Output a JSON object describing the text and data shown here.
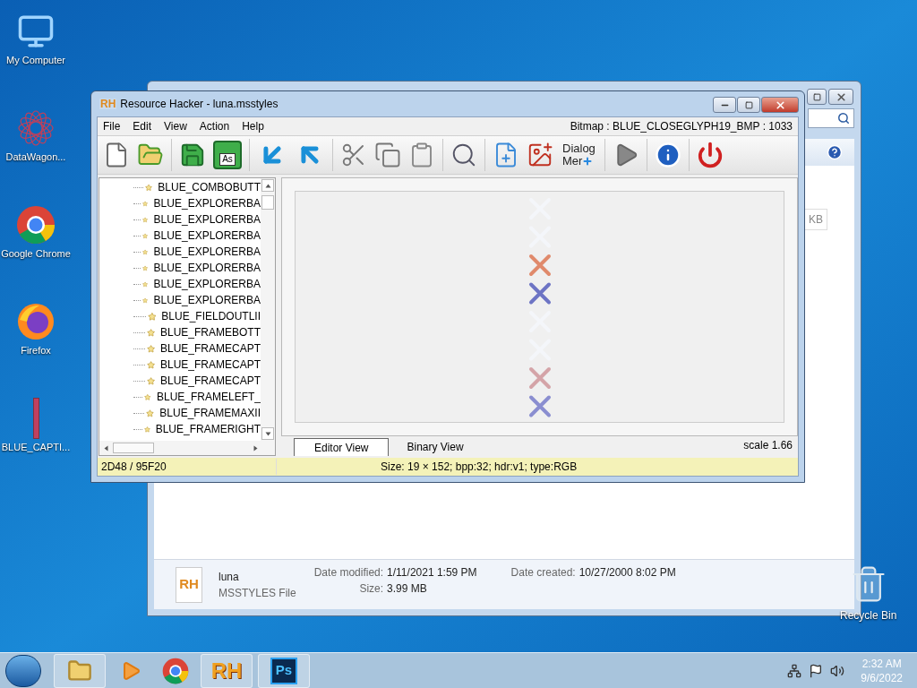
{
  "desktop_icons": [
    {
      "kind": "computer",
      "label": "My Computer"
    },
    {
      "kind": "datawagon",
      "label": "DataWagon..."
    },
    {
      "kind": "chrome",
      "label": "Google Chrome"
    },
    {
      "kind": "firefox",
      "label": "Firefox"
    },
    {
      "kind": "bitmap",
      "label": "BLUE_CAPTI..."
    }
  ],
  "recycle_bin": {
    "label": "Recycle Bin"
  },
  "explorer": {
    "size_fragment": "KB",
    "details": {
      "icon_text": "RH",
      "name": "luna",
      "type": "MSSTYLES File",
      "fields": [
        {
          "label": "Date modified:",
          "value": "1/11/2021 1:59 PM"
        },
        {
          "label": "Size:",
          "value": "3.99 MB"
        },
        {
          "label": "Date created:",
          "value": "10/27/2000 8:02 PM"
        }
      ]
    }
  },
  "window": {
    "logo": "RH",
    "title": "Resource Hacker - luna.msstyles",
    "menu": [
      "File",
      "Edit",
      "View",
      "Action",
      "Help"
    ],
    "resource_label": "Bitmap : BLUE_CLOSEGLYPH19_BMP : 1033",
    "toolbar": [
      [
        {
          "kind": "new"
        },
        {
          "kind": "open"
        }
      ],
      [
        {
          "kind": "save"
        },
        {
          "kind": "save_as",
          "label": "As"
        }
      ],
      [
        {
          "kind": "compile_down"
        },
        {
          "kind": "compile_up"
        }
      ],
      [
        {
          "kind": "cut"
        },
        {
          "kind": "copy"
        },
        {
          "kind": "paste"
        }
      ],
      [
        {
          "kind": "find"
        }
      ],
      [
        {
          "kind": "add_blank"
        },
        {
          "kind": "add_image"
        },
        {
          "kind": "dialog",
          "label": "Dialog",
          "label2": "Mer"
        }
      ],
      [
        {
          "kind": "run"
        }
      ],
      [
        {
          "kind": "info"
        }
      ],
      [
        {
          "kind": "power"
        }
      ]
    ],
    "tree": [
      "BLUE_COMBOBUTT",
      "BLUE_EXPLORERBA",
      "BLUE_EXPLORERBA",
      "BLUE_EXPLORERBA",
      "BLUE_EXPLORERBA",
      "BLUE_EXPLORERBA",
      "BLUE_EXPLORERBA",
      "BLUE_EXPLORERBA",
      "BLUE_FIELDOUTLII",
      "BLUE_FRAMEBOTT",
      "BLUE_FRAMECAPT",
      "BLUE_FRAMECAPT",
      "BLUE_FRAMECAPT",
      "BLUE_FRAMELEFT_",
      "BLUE_FRAMEMAXII",
      "BLUE_FRAMERIGHT"
    ],
    "glyphs": [
      {
        "color": "#f4f6fa"
      },
      {
        "color": "#f4f6fa"
      },
      {
        "color": "#e08a6c"
      },
      {
        "color": "#6d74c4"
      },
      {
        "color": "#f4f6fa"
      },
      {
        "color": "#f4f6fa"
      },
      {
        "color": "#d4a4a8"
      },
      {
        "color": "#8a8ed0"
      }
    ],
    "tabs": [
      {
        "label": "Editor View",
        "selected": true
      },
      {
        "label": "Binary View",
        "selected": false
      }
    ],
    "scale": "scale 1.66",
    "status": [
      "2D48 / 95F20",
      "Size: 19 × 152;  bpp:32;  hdr:v1;  type:RGB"
    ]
  },
  "taskbar": {
    "apps": [
      {
        "kind": "explorer",
        "open": true
      },
      {
        "kind": "media",
        "open": false
      },
      {
        "kind": "chrome",
        "open": false
      },
      {
        "kind": "rh",
        "label": "RH",
        "open": true
      },
      {
        "kind": "ps",
        "label": "Ps",
        "open": true
      }
    ],
    "time": "2:32 AM",
    "date": "9/6/2022"
  }
}
